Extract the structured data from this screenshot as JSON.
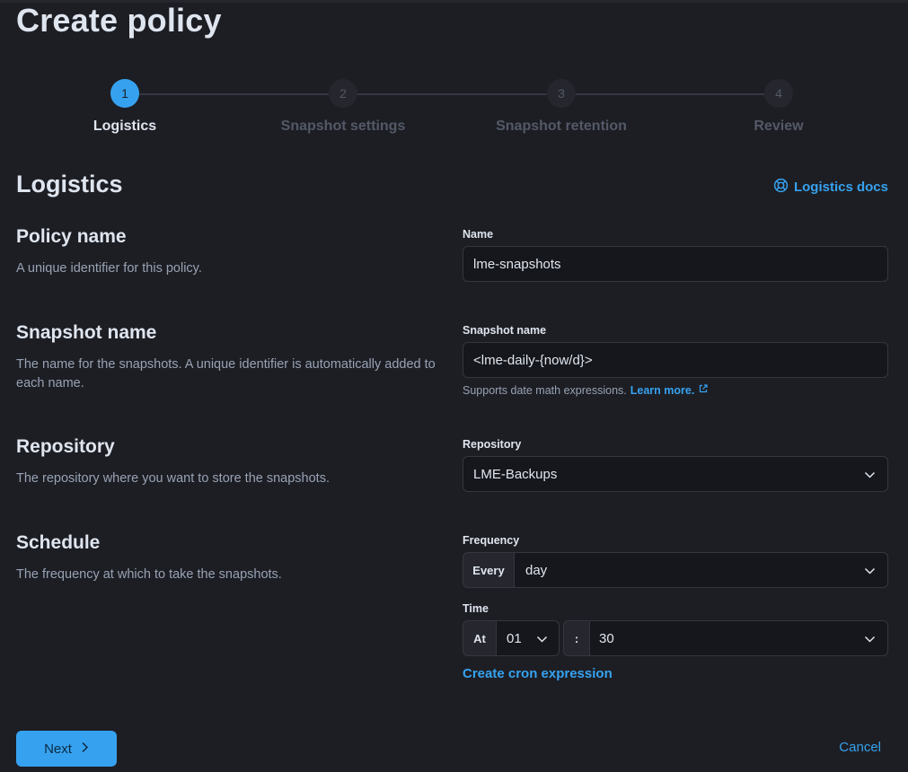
{
  "page": {
    "title": "Create policy"
  },
  "steps": [
    {
      "number": "1",
      "label": "Logistics",
      "active": true
    },
    {
      "number": "2",
      "label": "Snapshot settings",
      "active": false
    },
    {
      "number": "3",
      "label": "Snapshot retention",
      "active": false
    },
    {
      "number": "4",
      "label": "Review",
      "active": false
    }
  ],
  "section": {
    "title": "Logistics",
    "docs_link": "Logistics docs"
  },
  "policy_name": {
    "title": "Policy name",
    "description": "A unique identifier for this policy.",
    "label": "Name",
    "value": "lme-snapshots"
  },
  "snapshot_name": {
    "title": "Snapshot name",
    "description": "The name for the snapshots. A unique identifier is automatically added to each name.",
    "label": "Snapshot name",
    "value": "<lme-daily-{now/d}>",
    "help_text": "Supports date math expressions.",
    "help_link": "Learn more."
  },
  "repository": {
    "title": "Repository",
    "description": "The repository where you want to store the snapshots.",
    "label": "Repository",
    "value": "LME-Backups"
  },
  "schedule": {
    "title": "Schedule",
    "description": "The frequency at which to take the snapshots.",
    "frequency_label": "Frequency",
    "frequency_prepend": "Every",
    "frequency_value": "day",
    "time_label": "Time",
    "time_prepend": "At",
    "hour_value": "01",
    "separator": ":",
    "minute_value": "30",
    "cron_link": "Create cron expression"
  },
  "footer": {
    "next_label": "Next",
    "cancel_label": "Cancel"
  },
  "colors": {
    "accent": "#36a2ef",
    "background": "#1d1e24",
    "input_bg": "#16171c",
    "muted": "#98a2b3"
  }
}
